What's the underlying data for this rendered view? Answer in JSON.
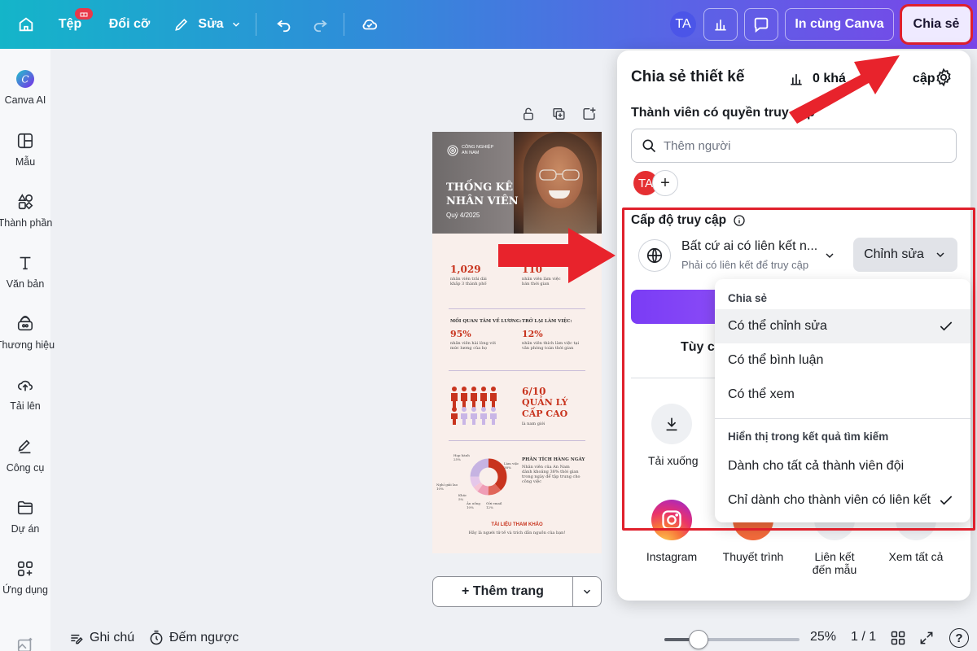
{
  "header": {
    "file_label": "Tệp",
    "file_badge": "",
    "resize_label": "Đổi cỡ",
    "edit_label": "Sửa",
    "avatar_initials": "TA",
    "print_label": "In cùng Canva",
    "share_label": "Chia sẻ"
  },
  "sidebar": {
    "items": [
      {
        "label": "Canva AI",
        "icon": "canva-ai-icon"
      },
      {
        "label": "Mẫu",
        "icon": "templates-icon"
      },
      {
        "label": "Thành phần",
        "icon": "elements-icon"
      },
      {
        "label": "Văn bản",
        "icon": "text-icon"
      },
      {
        "label": "Thương hiệu",
        "icon": "brand-icon"
      },
      {
        "label": "Tải lên",
        "icon": "upload-icon"
      },
      {
        "label": "Công cụ",
        "icon": "tools-icon"
      },
      {
        "label": "Dự án",
        "icon": "projects-icon"
      },
      {
        "label": "Ứng dụng",
        "icon": "apps-icon"
      }
    ]
  },
  "design": {
    "company_line1": "CÔNG NGHIỆP",
    "company_line2": "AN NAM",
    "title_line1": "THỐNG KÊ",
    "title_line2": "NHÂN VIÊN",
    "quarter": "Quý 4/2025",
    "stat1_value": "1,029",
    "stat1_desc1": "nhân viên trải dài",
    "stat1_desc2": "khắp 3 thành phố",
    "stat2_value": "110",
    "stat2_desc1": "nhân viên làm việc",
    "stat2_desc2": "bán thời gian",
    "stat3_head": "MỐI QUAN TÂM VỀ LƯƠNG:",
    "stat3_value": "95%",
    "stat3_desc1": "nhân viên hài lòng với",
    "stat3_desc2": "mức lương của họ",
    "stat4_head": "TRỞ LẠI LÀM VIỆC:",
    "stat4_value": "12%",
    "stat4_desc1": "nhân viên thích làm việc tại",
    "stat4_desc2": "văn phòng toàn thời gian",
    "mgmt_value": "6/10",
    "mgmt_line1": "QUẢN LÝ",
    "mgmt_line2": "CẤP CAO",
    "mgmt_sub": "là nam giới",
    "analysis_head": "PHÂN TÍCH HÀNG NGÀY",
    "analysis_desc1": "Nhân viên của An Nam",
    "analysis_desc2": "dành khoảng 38% thời gian",
    "analysis_desc3": "trong ngày để tập trung cho",
    "analysis_desc4": "công việc",
    "donut_labels": [
      {
        "label": "Họp hành",
        "value": "25%"
      },
      {
        "label": "Làm việc",
        "value": "38%"
      },
      {
        "label": "Nghỉ giải lao",
        "value": "10%"
      },
      {
        "label": "Khác",
        "value": "5%"
      },
      {
        "label": "Ăn uống",
        "value": "10%"
      },
      {
        "label": "Gửi email",
        "value": "12%"
      }
    ],
    "footer_head": "TÀI LIỆU THAM KHẢO",
    "footer_desc": "Hãy là người tử tế và trích dẫn nguồn của bạn!"
  },
  "canvas": {
    "add_page_label": "+ Thêm trang"
  },
  "bottom": {
    "notes_label": "Ghi chú",
    "timer_label": "Đếm ngược",
    "zoom": "25%",
    "zoom_fraction": 0.25,
    "pages": "1 / 1",
    "help": "?"
  },
  "share_panel": {
    "title": "Chia sẻ thiết kế",
    "visitors": "0 khá",
    "visitors_tail": "cập",
    "members_label": "Thành viên có quyền truy cập",
    "search_placeholder": "Thêm người",
    "member_initials": "TA",
    "access_label": "Cấp độ truy cập",
    "link_access_title": "Bất cứ ai có liên kết n...",
    "link_access_sub": "Phải có liên kết để truy cập",
    "role_label": "Chỉnh sửa",
    "customize_label": "Tùy ch",
    "download_label": "Tải xuống",
    "apps": [
      {
        "label_line1": "Instagram",
        "label_line2": ""
      },
      {
        "label_line1": "Thuyết trình",
        "label_line2": ""
      },
      {
        "label_line1": "Liên kết",
        "label_line2": "đến mẫu"
      },
      {
        "label_line1": "Xem tất cả",
        "label_line2": ""
      }
    ]
  },
  "role_menu": {
    "section1": "Chia sẻ",
    "options": [
      "Có thể chỉnh sửa",
      "Có thể bình luận",
      "Có thể xem"
    ],
    "selected_option": "Có thể chỉnh sửa",
    "section2": "Hiển thị trong kết quả tìm kiếm",
    "search_options": [
      "Dành cho tất cả thành viên đội",
      "Chỉ dành cho thành viên có liên kết"
    ],
    "selected_search_option": "Chỉ dành cho thành viên có liên kết"
  },
  "colors": {
    "accent_red": "#e0202c",
    "purple": "#7a3cf5",
    "stat_red": "#c8341e"
  }
}
